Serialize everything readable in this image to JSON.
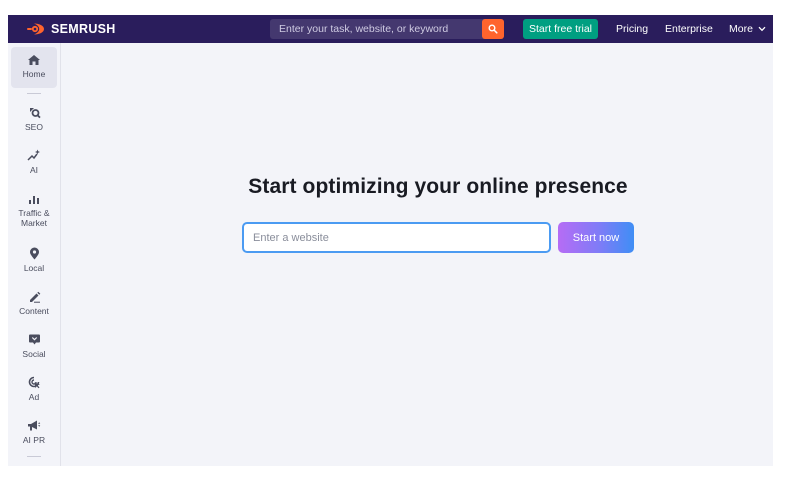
{
  "header": {
    "logo_text": "SEMRUSH",
    "search_placeholder": "Enter your task, website, or keyword",
    "trial_label": "Start free trial",
    "pricing_label": "Pricing",
    "enterprise_label": "Enterprise",
    "more_label": "More"
  },
  "sidebar": {
    "items": [
      {
        "label": "Home",
        "icon": "home-icon",
        "active": true
      },
      {
        "label": "SEO",
        "icon": "seo-icon"
      },
      {
        "label": "AI",
        "icon": "ai-sparkle-icon"
      },
      {
        "label": "Traffic &",
        "label2": "Market",
        "icon": "bar-chart-icon"
      },
      {
        "label": "Local",
        "icon": "map-pin-icon"
      },
      {
        "label": "Content",
        "icon": "pencil-icon"
      },
      {
        "label": "Social",
        "icon": "social-icon"
      },
      {
        "label": "Ad",
        "icon": "ad-target-icon"
      },
      {
        "label": "AI PR",
        "icon": "megaphone-icon"
      }
    ]
  },
  "main": {
    "title": "Start optimizing your online presence",
    "input_placeholder": "Enter a website",
    "button_label": "Start now"
  },
  "colors": {
    "header_bg": "#2a1d5c",
    "search_button": "#ff642d",
    "trial_button": "#009f81",
    "input_focus_border": "#4b9bf2",
    "start_button_gradient": [
      "#b66cf5",
      "#3f8ef5"
    ],
    "logo_orange": "#ff642d"
  }
}
